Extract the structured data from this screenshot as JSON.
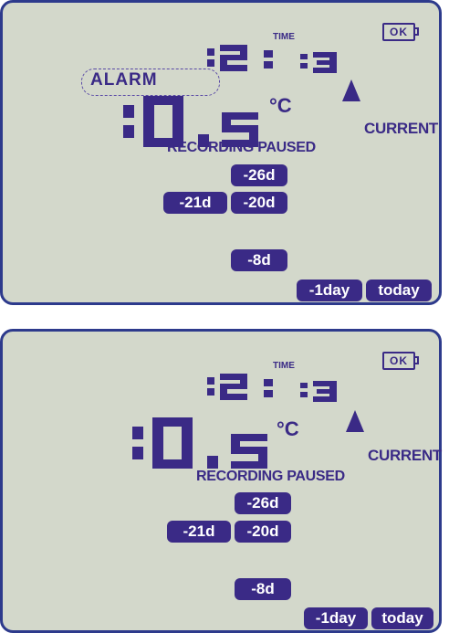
{
  "colors": {
    "lcd_bg": "#d3d8cb",
    "ink": "#3a2a86",
    "frame": "#2d3a8c"
  },
  "panels": [
    {
      "battery_status": "OK",
      "time_label": "TIME",
      "time_value": "12:13",
      "alarm_text": "ALARM",
      "temperature_value": "10.5",
      "temperature_unit": "°C",
      "trend": "up-arrow",
      "current_label": "CURRENT",
      "status_text": "RECORDING PAUSED",
      "history": [
        "-26d",
        "-21d",
        "-20d",
        "-8d",
        "-1day",
        "today"
      ]
    },
    {
      "battery_status": "OK",
      "time_label": "TIME",
      "time_value": "12:13",
      "temperature_value": "10.5",
      "temperature_unit": "°C",
      "trend": "up-arrow",
      "current_label": "CURRENT",
      "status_text": "RECORDING PAUSED",
      "history": [
        "-26d",
        "-21d",
        "-20d",
        "-8d",
        "-1day",
        "today"
      ]
    }
  ]
}
